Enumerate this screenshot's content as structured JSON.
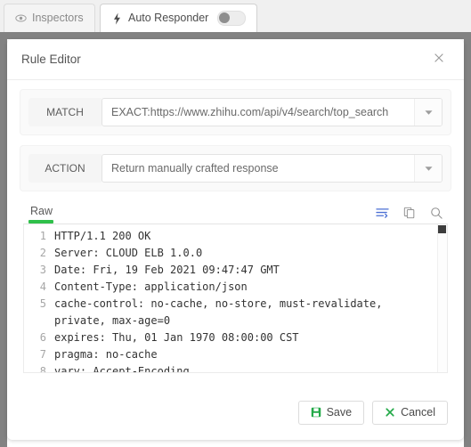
{
  "tabs": [
    {
      "label": "Inspectors",
      "icon": "eye-icon",
      "active": false
    },
    {
      "label": "Auto Responder",
      "icon": "lightning-icon",
      "active": true,
      "toggle": "off"
    }
  ],
  "modal": {
    "title": "Rule Editor",
    "close_icon": "close-icon",
    "fields": [
      {
        "label": "MATCH",
        "value": "EXACT:https://www.zhihu.com/api/v4/search/top_search",
        "caret_icon": "chevron-down-icon"
      },
      {
        "label": "ACTION",
        "value": "Return manually crafted response",
        "caret_icon": "chevron-down-icon"
      }
    ],
    "editor": {
      "tab_label": "Raw",
      "icons": [
        {
          "name": "word-wrap-icon",
          "active": true
        },
        {
          "name": "copy-icon",
          "active": false
        },
        {
          "name": "search-icon",
          "active": false
        }
      ],
      "lines": [
        {
          "number": "1",
          "text": "HTTP/1.1 200 OK"
        },
        {
          "number": "2",
          "text": "Server: CLOUD ELB 1.0.0"
        },
        {
          "number": "3",
          "text": "Date: Fri, 19 Feb 2021 09:47:47 GMT"
        },
        {
          "number": "4",
          "text": "Content-Type: application/json"
        },
        {
          "number": "5",
          "text": "cache-control: no-cache, no-store, must-revalidate, private, max-age=0"
        },
        {
          "number": "6",
          "text": "expires: Thu, 01 Jan 1970 08:00:00 CST"
        },
        {
          "number": "7",
          "text": "pragma: no-cache"
        },
        {
          "number": "8",
          "text": "vary: Accept-Encoding"
        }
      ]
    },
    "buttons": [
      {
        "label": "Save",
        "icon": "save-disk-icon"
      },
      {
        "label": "Cancel",
        "icon": "x-mark-icon"
      }
    ]
  },
  "colors": {
    "accent_green": "#2fc04a",
    "icon_blue": "#4a6fd4",
    "band_gray": "#828282"
  }
}
